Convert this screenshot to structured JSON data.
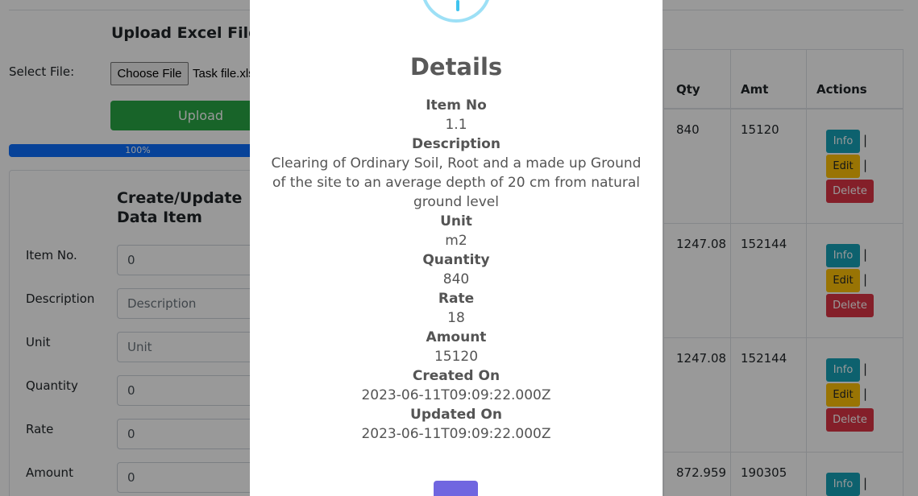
{
  "upload": {
    "title": "Upload Excel File",
    "select_label": "Select File:",
    "choose_button": "Choose File",
    "file_name": "Task file.xlsx",
    "upload_button": "Upload",
    "progress_percent": 100,
    "progress_label": "100%"
  },
  "form": {
    "title": "Create/Update Data Item",
    "fields": [
      {
        "label": "Item No.",
        "value": "0",
        "placeholder": ""
      },
      {
        "label": "Description",
        "value": "",
        "placeholder": "Description"
      },
      {
        "label": "Unit",
        "value": "",
        "placeholder": "Unit"
      },
      {
        "label": "Quantity",
        "value": "0",
        "placeholder": ""
      },
      {
        "label": "Rate",
        "value": "0",
        "placeholder": ""
      },
      {
        "label": "Amount",
        "value": "0",
        "placeholder": ""
      }
    ]
  },
  "table": {
    "headers": {
      "qty": "Qty",
      "amt": "Amt",
      "actions": "Actions"
    },
    "rows": [
      {
        "qty": "840",
        "amt": "15120"
      },
      {
        "qty": "1247.08",
        "amt": "152144"
      },
      {
        "qty": "1247.08",
        "amt": "152144"
      },
      {
        "qty": "872.959",
        "amt": "190305"
      }
    ],
    "actions": {
      "info": "Info",
      "edit": "Edit",
      "delete": "Delete",
      "separator": "|"
    }
  },
  "modal": {
    "title": "Details",
    "icon": "info-icon",
    "lines": [
      {
        "key": "Item No",
        "value": "1.1"
      },
      {
        "key": "Description",
        "value": "Clearing of Ordinary Soil, Root and a made up Ground of the site to an average depth of 20 cm from natural ground level"
      },
      {
        "key": "Unit",
        "value": "m2"
      },
      {
        "key": "Quantity",
        "value": "840"
      },
      {
        "key": "Rate",
        "value": "18"
      },
      {
        "key": "Amount",
        "value": "15120"
      },
      {
        "key": "Created On",
        "value": "2023-06-11T09:09:22.000Z"
      },
      {
        "key": "Updated On",
        "value": "2023-06-11T09:09:22.000Z"
      }
    ],
    "ok_color": "#7066e0"
  }
}
